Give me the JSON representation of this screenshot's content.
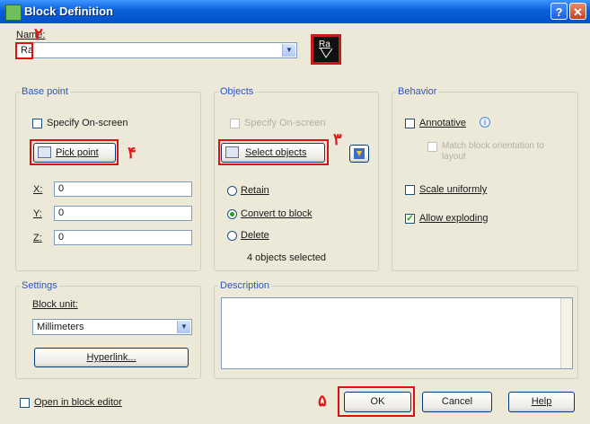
{
  "window": {
    "title": "Block Definition",
    "help_glyph": "?",
    "close_glyph": "✕"
  },
  "name": {
    "label": "Name:",
    "value": "Ra",
    "preview_text": "Ra"
  },
  "base_point": {
    "title": "Base point",
    "specify_onscreen": "Specify On-screen",
    "pick_point": "Pick point",
    "x_label": "X:",
    "x_value": "0",
    "y_label": "Y:",
    "y_value": "0",
    "z_label": "Z:",
    "z_value": "0"
  },
  "objects": {
    "title": "Objects",
    "specify_onscreen": "Specify On-screen",
    "select_objects": "Select objects",
    "retain": "Retain",
    "convert": "Convert to block",
    "delete": "Delete",
    "selected_count": "4 objects selected"
  },
  "behavior": {
    "title": "Behavior",
    "annotative": "Annotative",
    "match_orientation": "Match block orientation to layout",
    "scale_uniformly": "Scale uniformly",
    "allow_exploding": "Allow exploding"
  },
  "settings": {
    "title": "Settings",
    "block_unit_label": "Block unit:",
    "block_unit_value": "Millimeters",
    "hyperlink": "Hyperlink..."
  },
  "description": {
    "title": "Description"
  },
  "footer": {
    "open_in_editor": "Open in block editor",
    "ok": "OK",
    "cancel": "Cancel",
    "help": "Help"
  },
  "annotations": {
    "m2": "٢",
    "m3": "٣",
    "m4": "۴",
    "m5": "۵"
  }
}
